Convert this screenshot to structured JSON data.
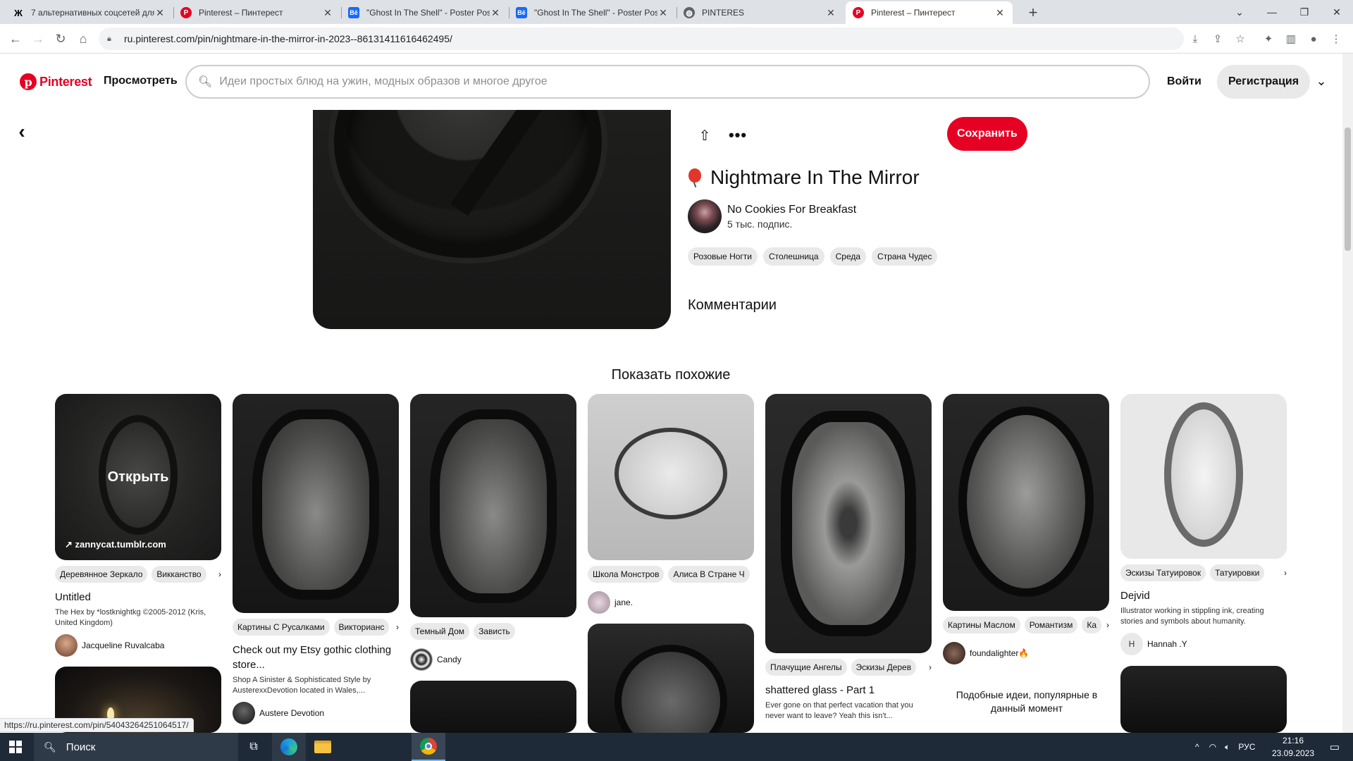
{
  "browser": {
    "tabs": [
      {
        "title": "7 альтернативных соцсетей для",
        "icon": "zen-icon",
        "color": "#000000"
      },
      {
        "title": "Pinterest – Пинтерест",
        "icon": "pinterest-icon",
        "color": "#e60023"
      },
      {
        "title": "\"Ghost In The Shell\" - Poster Pos",
        "icon": "behance-icon",
        "color": "#1769ff"
      },
      {
        "title": "\"Ghost In The Shell\" - Poster Pos",
        "icon": "behance-icon",
        "color": "#1769ff"
      },
      {
        "title": "PINTERES",
        "icon": "globe-icon",
        "color": "#5f6368"
      },
      {
        "title": "Pinterest – Пинтерест",
        "icon": "pinterest-icon",
        "color": "#e60023"
      }
    ],
    "url": "ru.pinterest.com/pin/nightmare-in-the-mirror-in-2023--861314116164624​95/",
    "status_url": "https://ru.pinterest.com/pin/540432642510645​17/"
  },
  "header": {
    "logo": "Pinterest",
    "explore": "Просмотреть",
    "search_placeholder": "Идеи простых блюд на ужин, модных образов и многое другое",
    "login": "Войти",
    "signup": "Регистрация"
  },
  "pin": {
    "save": "Сохранить",
    "title": "Nightmare In The Mirror",
    "author": "No Cookies For Breakfast",
    "followers": "5 тыс. подпис.",
    "tags": [
      "Розовые Ногти",
      "Столешница",
      "Среда",
      "Страна Чудес"
    ],
    "comments_label": "Комментарии"
  },
  "more_like_this": "Показать похожие",
  "cards": [
    {
      "open": "Открыть",
      "link": "zannycat.tumblr.com",
      "chips": [
        "Деревянное Зеркало",
        "Викканство"
      ],
      "title": "Untitled",
      "desc": "The Hex by *lostknightkg ©2005-2012 (Kris, United Kingdom)",
      "user": "Jacqueline Ruvalcaba"
    },
    {
      "chips": [
        "Картины С Русалками",
        "Викторианс"
      ],
      "title": "Check out my Etsy gothic clothing store...",
      "desc": "Shop A Sinister & Sophisticated Style by AusterexxDevotion located in Wales,...",
      "user": "Austere Devotion"
    },
    {
      "chips": [
        "Темный Дом",
        "Зависть"
      ],
      "user": "Candy"
    },
    {
      "chips": [
        "Школа Монстров",
        "Алиса В Стране Ч"
      ],
      "user": "jane."
    },
    {
      "chips": [
        "Плачущие Ангелы",
        "Эскизы Дерев"
      ],
      "title": "shattered glass - Part 1",
      "desc": "Ever gone on that perfect vacation that you never want to leave? Yeah this isn't..."
    },
    {
      "chips": [
        "Картины Маслом",
        "Романтизм",
        "Ка"
      ],
      "user": "foundalighter🔥",
      "popular": "Подобные идеи, популярные в данный момент"
    },
    {
      "chips": [
        "Эскизы Татуировок",
        "Татуировки"
      ],
      "title": "Dejvid",
      "desc": "Illustrator working in stippling ink, creating stories and symbols about humanity.",
      "user": "Hannah .Y",
      "user_initial": "H"
    }
  ],
  "taskbar": {
    "search": "Поиск",
    "lang": "РУС",
    "time": "21:16",
    "date": "23.09.2023"
  },
  "colors": {
    "brand": "#e60023",
    "taskbar": "#1f2a38"
  }
}
